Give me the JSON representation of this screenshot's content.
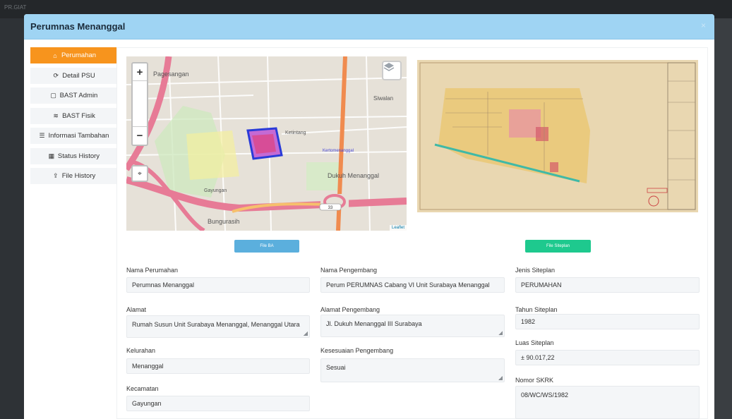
{
  "backdrop": {
    "brand": "PR.GIAT"
  },
  "modal": {
    "title": "Perumnas Menanggal",
    "close_icon": "×"
  },
  "menu": [
    {
      "label": "Perumahan",
      "icon": "⌂",
      "active": true
    },
    {
      "label": "Detail PSU",
      "icon": "⟳"
    },
    {
      "label": "BAST Admin",
      "icon": "▢"
    },
    {
      "label": "BAST Fisik",
      "icon": "≋"
    },
    {
      "label": "Informasi Tambahan",
      "icon": "☰"
    },
    {
      "label": "Status History",
      "icon": "▦"
    },
    {
      "label": "File History",
      "icon": "⇪"
    }
  ],
  "map": {
    "zoom_in": "+",
    "zoom_out": "−",
    "locate_icon": "⌖",
    "attribution": "Leaflet",
    "place_labels": [
      "Pagesangan",
      "Gayungan",
      "Dukuh Menanggal",
      "Siwalan",
      "Bungurasih",
      "Ketintang",
      "Kertomenanggal"
    ],
    "highway_shield": "33"
  },
  "buttons": {
    "file_ba": "File BA",
    "file_siteplan": "File Siteplan"
  },
  "form": {
    "nama_perumahan": {
      "label": "Nama Perumahan",
      "value": "Perumnas Menanggal"
    },
    "alamat": {
      "label": "Alamat",
      "value": "Rumah Susun Unit Surabaya Menanggal, Menanggal Utara"
    },
    "kelurahan": {
      "label": "Kelurahan",
      "value": "Menanggal"
    },
    "kecamatan": {
      "label": "Kecamatan",
      "value": "Gayungan"
    },
    "nama_pengembang": {
      "label": "Nama Pengembang",
      "value": "Perum PERUMNAS Cabang VI Unit Surabaya Menanggal"
    },
    "alamat_pengembang": {
      "label": "Alamat Pengembang",
      "value": "Jl. Dukuh Menanggal III Surabaya"
    },
    "kesesuaian_pengembang": {
      "label": "Kesesuaian Pengembang",
      "value": "Sesuai"
    },
    "jenis_siteplan": {
      "label": "Jenis Siteplan",
      "value": "PERUMAHAN"
    },
    "tahun_siteplan": {
      "label": "Tahun Siteplan",
      "value": "1982"
    },
    "luas_siteplan": {
      "label": "Luas Siteplan",
      "value": "± 90.017,22"
    },
    "nomor_skrk": {
      "label": "Nomor SKRK",
      "value": "08/WC/WS/1982"
    }
  }
}
